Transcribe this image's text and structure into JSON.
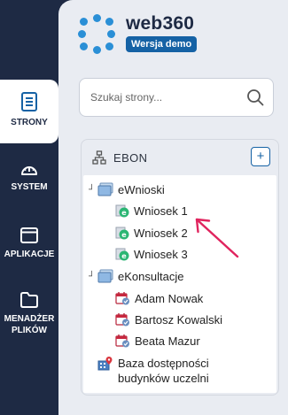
{
  "app": {
    "name": "web360",
    "badge": "Wersja demo"
  },
  "nav": [
    {
      "label": "STRONY",
      "icon": "document-icon",
      "active": true
    },
    {
      "label": "SYSTEM",
      "icon": "gauge-icon",
      "active": false
    },
    {
      "label": "APLIKACJE",
      "icon": "window-icon",
      "active": false
    },
    {
      "label": "MENADŻER PLIKÓW",
      "label_line1": "MENADŻER",
      "label_line2": "PLIKÓW",
      "icon": "folder-icon",
      "active": false
    }
  ],
  "search": {
    "placeholder": "Szukaj strony..."
  },
  "tree": {
    "root": "EBON",
    "add_label": "+",
    "groups": [
      {
        "label": "eWnioski",
        "toggle": "┘",
        "items": [
          "Wniosek 1",
          "Wniosek 2",
          "Wniosek 3"
        ]
      },
      {
        "label": "eKonsultacje",
        "toggle": "┘",
        "items": [
          "Adam Nowak",
          "Bartosz Kowalski",
          "Beata Mazur"
        ]
      }
    ],
    "extra": {
      "line1": "Baza dostępności",
      "line2": "budynków uczelni"
    }
  },
  "colors": {
    "rail": "#1e2a44",
    "panel": "#e9ecf2",
    "accent": "#1562a5",
    "logo": "#2a8fd6",
    "annotation_arrow": "#e0245e"
  }
}
